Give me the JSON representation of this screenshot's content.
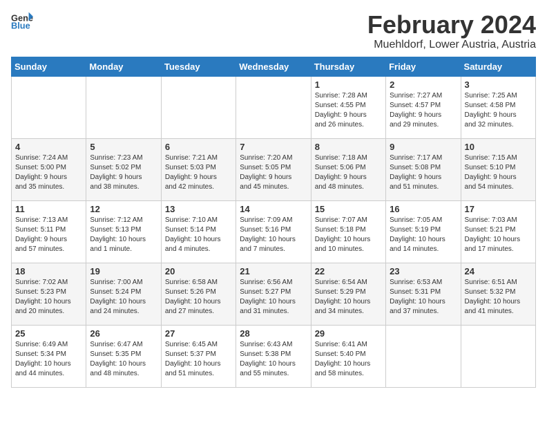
{
  "header": {
    "logo_general": "General",
    "logo_blue": "Blue",
    "month_title": "February 2024",
    "location": "Muehldorf, Lower Austria, Austria"
  },
  "weekdays": [
    "Sunday",
    "Monday",
    "Tuesday",
    "Wednesday",
    "Thursday",
    "Friday",
    "Saturday"
  ],
  "weeks": [
    [
      {
        "day": "",
        "info": ""
      },
      {
        "day": "",
        "info": ""
      },
      {
        "day": "",
        "info": ""
      },
      {
        "day": "",
        "info": ""
      },
      {
        "day": "1",
        "info": "Sunrise: 7:28 AM\nSunset: 4:55 PM\nDaylight: 9 hours\nand 26 minutes."
      },
      {
        "day": "2",
        "info": "Sunrise: 7:27 AM\nSunset: 4:57 PM\nDaylight: 9 hours\nand 29 minutes."
      },
      {
        "day": "3",
        "info": "Sunrise: 7:25 AM\nSunset: 4:58 PM\nDaylight: 9 hours\nand 32 minutes."
      }
    ],
    [
      {
        "day": "4",
        "info": "Sunrise: 7:24 AM\nSunset: 5:00 PM\nDaylight: 9 hours\nand 35 minutes."
      },
      {
        "day": "5",
        "info": "Sunrise: 7:23 AM\nSunset: 5:02 PM\nDaylight: 9 hours\nand 38 minutes."
      },
      {
        "day": "6",
        "info": "Sunrise: 7:21 AM\nSunset: 5:03 PM\nDaylight: 9 hours\nand 42 minutes."
      },
      {
        "day": "7",
        "info": "Sunrise: 7:20 AM\nSunset: 5:05 PM\nDaylight: 9 hours\nand 45 minutes."
      },
      {
        "day": "8",
        "info": "Sunrise: 7:18 AM\nSunset: 5:06 PM\nDaylight: 9 hours\nand 48 minutes."
      },
      {
        "day": "9",
        "info": "Sunrise: 7:17 AM\nSunset: 5:08 PM\nDaylight: 9 hours\nand 51 minutes."
      },
      {
        "day": "10",
        "info": "Sunrise: 7:15 AM\nSunset: 5:10 PM\nDaylight: 9 hours\nand 54 minutes."
      }
    ],
    [
      {
        "day": "11",
        "info": "Sunrise: 7:13 AM\nSunset: 5:11 PM\nDaylight: 9 hours\nand 57 minutes."
      },
      {
        "day": "12",
        "info": "Sunrise: 7:12 AM\nSunset: 5:13 PM\nDaylight: 10 hours\nand 1 minute."
      },
      {
        "day": "13",
        "info": "Sunrise: 7:10 AM\nSunset: 5:14 PM\nDaylight: 10 hours\nand 4 minutes."
      },
      {
        "day": "14",
        "info": "Sunrise: 7:09 AM\nSunset: 5:16 PM\nDaylight: 10 hours\nand 7 minutes."
      },
      {
        "day": "15",
        "info": "Sunrise: 7:07 AM\nSunset: 5:18 PM\nDaylight: 10 hours\nand 10 minutes."
      },
      {
        "day": "16",
        "info": "Sunrise: 7:05 AM\nSunset: 5:19 PM\nDaylight: 10 hours\nand 14 minutes."
      },
      {
        "day": "17",
        "info": "Sunrise: 7:03 AM\nSunset: 5:21 PM\nDaylight: 10 hours\nand 17 minutes."
      }
    ],
    [
      {
        "day": "18",
        "info": "Sunrise: 7:02 AM\nSunset: 5:23 PM\nDaylight: 10 hours\nand 20 minutes."
      },
      {
        "day": "19",
        "info": "Sunrise: 7:00 AM\nSunset: 5:24 PM\nDaylight: 10 hours\nand 24 minutes."
      },
      {
        "day": "20",
        "info": "Sunrise: 6:58 AM\nSunset: 5:26 PM\nDaylight: 10 hours\nand 27 minutes."
      },
      {
        "day": "21",
        "info": "Sunrise: 6:56 AM\nSunset: 5:27 PM\nDaylight: 10 hours\nand 31 minutes."
      },
      {
        "day": "22",
        "info": "Sunrise: 6:54 AM\nSunset: 5:29 PM\nDaylight: 10 hours\nand 34 minutes."
      },
      {
        "day": "23",
        "info": "Sunrise: 6:53 AM\nSunset: 5:31 PM\nDaylight: 10 hours\nand 37 minutes."
      },
      {
        "day": "24",
        "info": "Sunrise: 6:51 AM\nSunset: 5:32 PM\nDaylight: 10 hours\nand 41 minutes."
      }
    ],
    [
      {
        "day": "25",
        "info": "Sunrise: 6:49 AM\nSunset: 5:34 PM\nDaylight: 10 hours\nand 44 minutes."
      },
      {
        "day": "26",
        "info": "Sunrise: 6:47 AM\nSunset: 5:35 PM\nDaylight: 10 hours\nand 48 minutes."
      },
      {
        "day": "27",
        "info": "Sunrise: 6:45 AM\nSunset: 5:37 PM\nDaylight: 10 hours\nand 51 minutes."
      },
      {
        "day": "28",
        "info": "Sunrise: 6:43 AM\nSunset: 5:38 PM\nDaylight: 10 hours\nand 55 minutes."
      },
      {
        "day": "29",
        "info": "Sunrise: 6:41 AM\nSunset: 5:40 PM\nDaylight: 10 hours\nand 58 minutes."
      },
      {
        "day": "",
        "info": ""
      },
      {
        "day": "",
        "info": ""
      }
    ]
  ]
}
